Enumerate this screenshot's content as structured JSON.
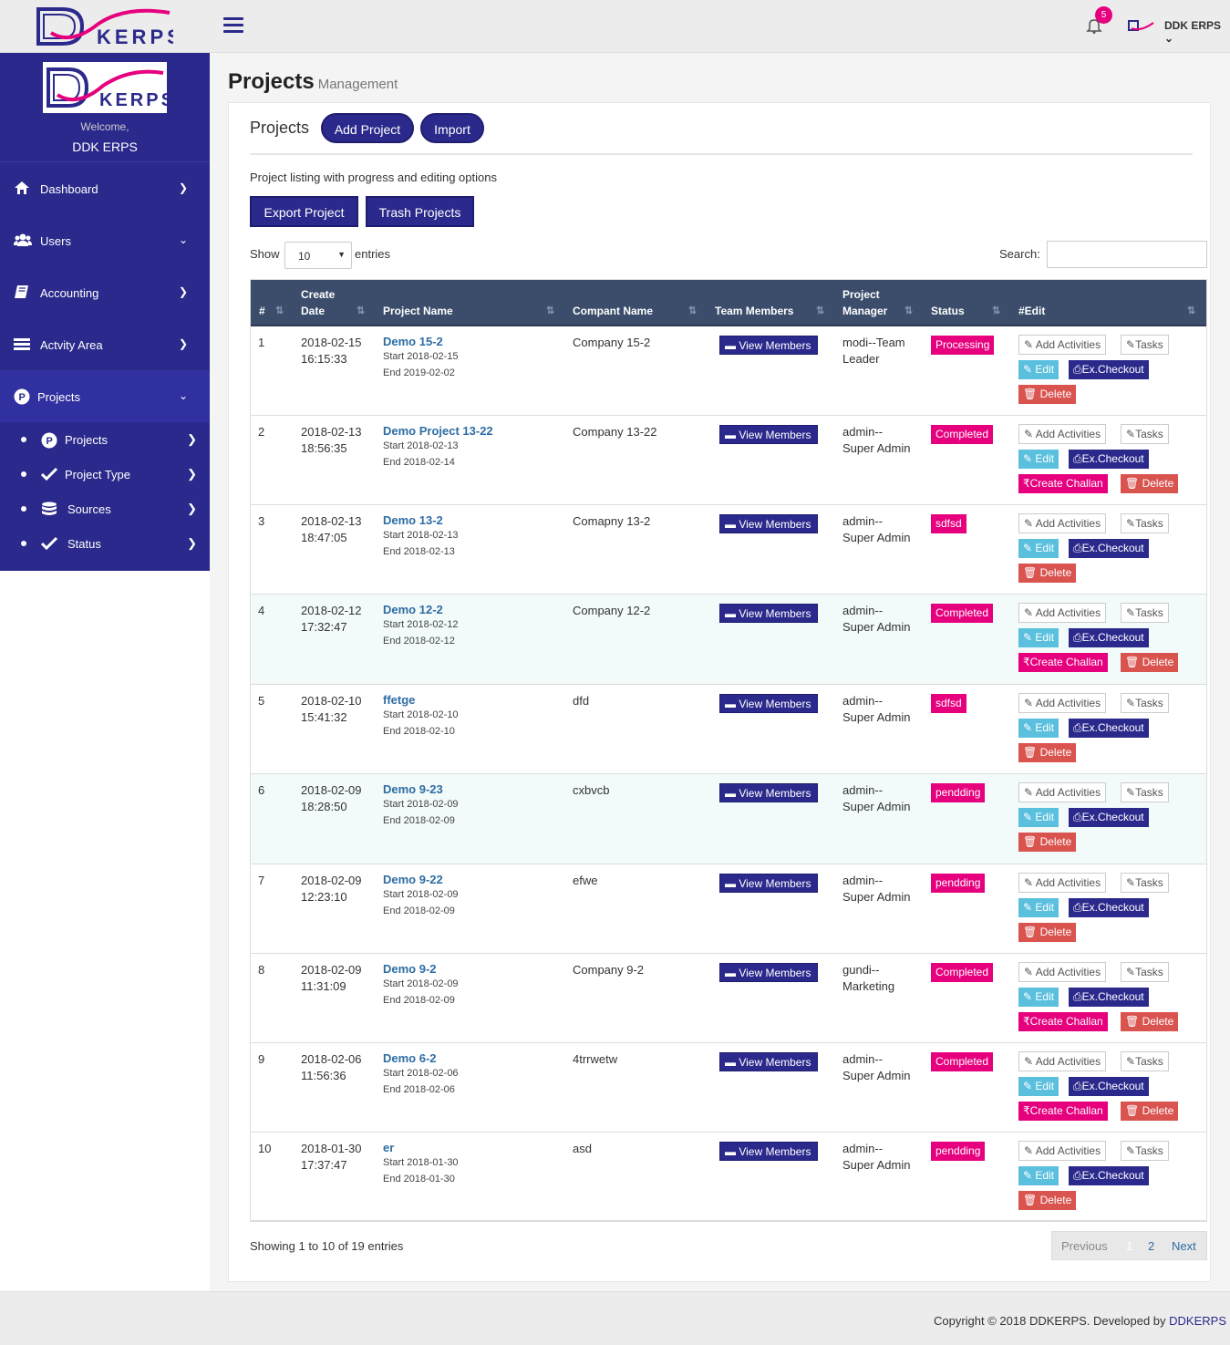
{
  "brand": {
    "logo_text": "KERPS"
  },
  "topbar": {
    "notif_count": "5",
    "user_name": "DDK ERPS"
  },
  "sidebar": {
    "welcome": "Welcome,",
    "user": "DDK ERPS",
    "items": [
      {
        "label": "Dashboard",
        "icon": "home-icon"
      },
      {
        "label": "Users",
        "icon": "users-icon"
      },
      {
        "label": "Accounting",
        "icon": "book-icon"
      },
      {
        "label": "Actvity Area",
        "icon": "list-icon"
      },
      {
        "label": "Projects",
        "icon": "p-circle-icon"
      }
    ],
    "sub": [
      {
        "label": "Projects",
        "icon": "p-circle-icon"
      },
      {
        "label": "Project Type",
        "icon": "check-icon"
      },
      {
        "label": "Sources",
        "icon": "database-icon"
      },
      {
        "label": "Status",
        "icon": "check-icon"
      }
    ]
  },
  "page": {
    "title": "Projects",
    "subtitle": "Management"
  },
  "box": {
    "title": "Projects",
    "add": "Add Project",
    "import": "Import",
    "desc": "Project listing with progress and editing options",
    "export": "Export Project",
    "trash": "Trash Projects",
    "show": "Show",
    "entries": "entries",
    "len": "10",
    "search": "Search:"
  },
  "table": {
    "headers": {
      "num": "#",
      "date1": "Create",
      "date2": "Date",
      "name": "Project Name",
      "company": "Compant Name",
      "team": "Team Members",
      "pm1": "Project",
      "pm2": "Manager",
      "status": "Status",
      "edit": "#Edit"
    },
    "rows": [
      {
        "n": "1",
        "d1": "2018-02-15",
        "d2": "16:15:33",
        "name": "Demo 15-2",
        "start": "Start 2018-02-15",
        "end": "End 2019-02-02",
        "company": "Company 15-2",
        "pm1": "modi--Team",
        "pm2": "Leader",
        "status": "Processing",
        "challan": false
      },
      {
        "n": "2",
        "d1": "2018-02-13",
        "d2": "18:56:35",
        "name": "Demo Project 13-22",
        "start": "Start 2018-02-13",
        "end": "End 2018-02-14",
        "company": "Company 13-22",
        "pm1": "admin--",
        "pm2": "Super Admin",
        "status": "Completed",
        "challan": true
      },
      {
        "n": "3",
        "d1": "2018-02-13",
        "d2": "18:47:05",
        "name": "Demo 13-2",
        "start": "Start 2018-02-13",
        "end": "End 2018-02-13",
        "company": "Comapny 13-2",
        "pm1": "admin--",
        "pm2": "Super Admin",
        "status": "sdfsd",
        "challan": false
      },
      {
        "n": "4",
        "d1": "2018-02-12",
        "d2": "17:32:47",
        "name": "Demo 12-2",
        "start": "Start 2018-02-12",
        "end": "End 2018-02-12",
        "company": "Company 12-2",
        "pm1": "admin--",
        "pm2": "Super Admin",
        "status": "Completed",
        "challan": true
      },
      {
        "n": "5",
        "d1": "2018-02-10",
        "d2": "15:41:32",
        "name": "ffetge",
        "start": "Start 2018-02-10",
        "end": "End 2018-02-10",
        "company": "dfd",
        "pm1": "admin--",
        "pm2": "Super Admin",
        "status": "sdfsd",
        "challan": false
      },
      {
        "n": "6",
        "d1": "2018-02-09",
        "d2": "18:28:50",
        "name": "Demo 9-23",
        "start": "Start 2018-02-09",
        "end": "End 2018-02-09",
        "company": "cxbvcb",
        "pm1": "admin--",
        "pm2": "Super Admin",
        "status": "pendding",
        "challan": false
      },
      {
        "n": "7",
        "d1": "2018-02-09",
        "d2": "12:23:10",
        "name": "Demo 9-22",
        "start": "Start 2018-02-09",
        "end": "End 2018-02-09",
        "company": "efwe",
        "pm1": "admin--",
        "pm2": "Super Admin",
        "status": "pendding",
        "challan": false
      },
      {
        "n": "8",
        "d1": "2018-02-09",
        "d2": "11:31:09",
        "name": "Demo 9-2",
        "start": "Start 2018-02-09",
        "end": "End 2018-02-09",
        "company": "Company 9-2",
        "pm1": "gundi--",
        "pm2": "Marketing",
        "status": "Completed",
        "challan": true
      },
      {
        "n": "9",
        "d1": "2018-02-06",
        "d2": "11:56:36",
        "name": "Demo 6-2",
        "start": "Start 2018-02-06",
        "end": "End 2018-02-06",
        "company": "4trrwetw",
        "pm1": "admin--",
        "pm2": "Super Admin",
        "status": "Completed",
        "challan": true
      },
      {
        "n": "10",
        "d1": "2018-01-30",
        "d2": "17:37:47",
        "name": "er",
        "start": "Start 2018-01-30",
        "end": "End 2018-01-30",
        "company": "asd",
        "pm1": "admin--",
        "pm2": "Super Admin",
        "status": "pendding",
        "challan": false
      }
    ],
    "actions": {
      "view": "View Members",
      "add": "Add Activities",
      "tasks": "Tasks",
      "edit": "Edit",
      "checkout": "Ex.Checkout",
      "challan": "Create Challan",
      "delete": "Delete"
    }
  },
  "pagination": {
    "info": "Showing 1 to 10 of 19 entries",
    "prev": "Previous",
    "p1": "1",
    "p2": "2",
    "next": "Next"
  },
  "footer": {
    "text": "Copyright © 2018 DDKERPS. Developed by ",
    "link": "DDKERPS"
  }
}
